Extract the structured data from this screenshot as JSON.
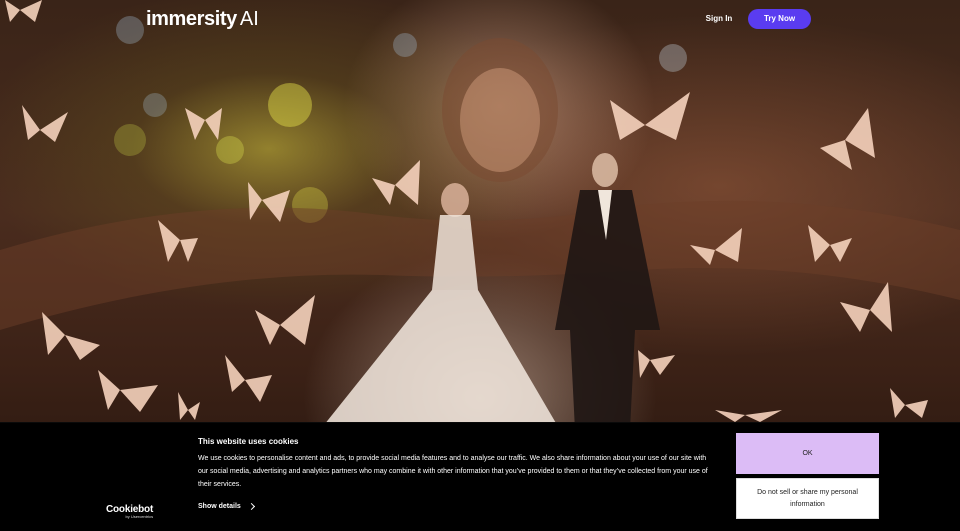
{
  "header": {
    "logo_text": "immersity",
    "logo_suffix": "AI",
    "sign_in_label": "Sign In",
    "try_now_label": "Try Now"
  },
  "cookie_banner": {
    "brand_name": "Cookiebot",
    "brand_sub": "by Usercentrics",
    "title": "This website uses cookies",
    "body": "We use cookies to personalise content and ads, to provide social media features and to analyse our traffic. We also share information about your use of our site with our social media, advertising and analytics partners who may combine it with other information that you’ve provided to them or that they’ve collected from your use of their services.",
    "show_details_label": "Show details",
    "ok_label": "OK",
    "do_not_sell_label": "Do not sell or share my personal information"
  },
  "colors": {
    "accent": "#5a3cf0",
    "ok_button": "#dcbcf6",
    "banner_bg": "#000000"
  }
}
